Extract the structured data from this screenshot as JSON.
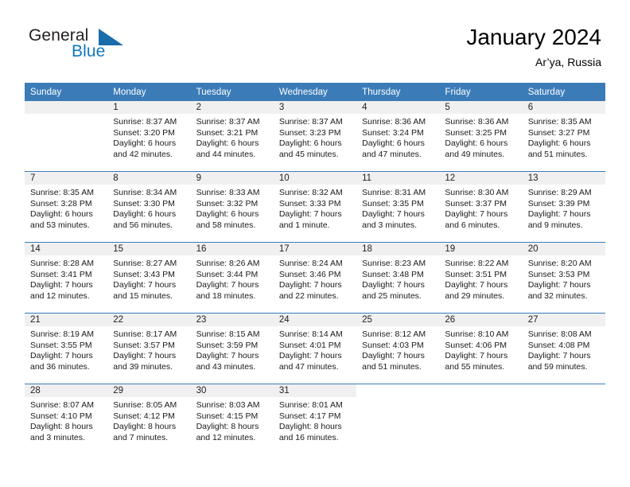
{
  "brand": {
    "name_part1": "General",
    "name_part2": "Blue",
    "triangle_color": "#1b6cab",
    "blue_color": "#1278be"
  },
  "header": {
    "title": "January 2024",
    "location": "Ar’ya, Russia"
  },
  "theme": {
    "header_blue": "#3b7cb8",
    "daynum_band": "#f0f0f0",
    "text": "#000000"
  },
  "calendar": {
    "weekday_headers": [
      "Sunday",
      "Monday",
      "Tuesday",
      "Wednesday",
      "Thursday",
      "Friday",
      "Saturday"
    ],
    "weeks": [
      [
        {
          "day": "",
          "sunrise": "",
          "sunset": "",
          "daylight1": "",
          "daylight2": ""
        },
        {
          "day": "1",
          "sunrise": "Sunrise: 8:37 AM",
          "sunset": "Sunset: 3:20 PM",
          "daylight1": "Daylight: 6 hours",
          "daylight2": "and 42 minutes."
        },
        {
          "day": "2",
          "sunrise": "Sunrise: 8:37 AM",
          "sunset": "Sunset: 3:21 PM",
          "daylight1": "Daylight: 6 hours",
          "daylight2": "and 44 minutes."
        },
        {
          "day": "3",
          "sunrise": "Sunrise: 8:37 AM",
          "sunset": "Sunset: 3:23 PM",
          "daylight1": "Daylight: 6 hours",
          "daylight2": "and 45 minutes."
        },
        {
          "day": "4",
          "sunrise": "Sunrise: 8:36 AM",
          "sunset": "Sunset: 3:24 PM",
          "daylight1": "Daylight: 6 hours",
          "daylight2": "and 47 minutes."
        },
        {
          "day": "5",
          "sunrise": "Sunrise: 8:36 AM",
          "sunset": "Sunset: 3:25 PM",
          "daylight1": "Daylight: 6 hours",
          "daylight2": "and 49 minutes."
        },
        {
          "day": "6",
          "sunrise": "Sunrise: 8:35 AM",
          "sunset": "Sunset: 3:27 PM",
          "daylight1": "Daylight: 6 hours",
          "daylight2": "and 51 minutes."
        }
      ],
      [
        {
          "day": "7",
          "sunrise": "Sunrise: 8:35 AM",
          "sunset": "Sunset: 3:28 PM",
          "daylight1": "Daylight: 6 hours",
          "daylight2": "and 53 minutes."
        },
        {
          "day": "8",
          "sunrise": "Sunrise: 8:34 AM",
          "sunset": "Sunset: 3:30 PM",
          "daylight1": "Daylight: 6 hours",
          "daylight2": "and 56 minutes."
        },
        {
          "day": "9",
          "sunrise": "Sunrise: 8:33 AM",
          "sunset": "Sunset: 3:32 PM",
          "daylight1": "Daylight: 6 hours",
          "daylight2": "and 58 minutes."
        },
        {
          "day": "10",
          "sunrise": "Sunrise: 8:32 AM",
          "sunset": "Sunset: 3:33 PM",
          "daylight1": "Daylight: 7 hours",
          "daylight2": "and 1 minute."
        },
        {
          "day": "11",
          "sunrise": "Sunrise: 8:31 AM",
          "sunset": "Sunset: 3:35 PM",
          "daylight1": "Daylight: 7 hours",
          "daylight2": "and 3 minutes."
        },
        {
          "day": "12",
          "sunrise": "Sunrise: 8:30 AM",
          "sunset": "Sunset: 3:37 PM",
          "daylight1": "Daylight: 7 hours",
          "daylight2": "and 6 minutes."
        },
        {
          "day": "13",
          "sunrise": "Sunrise: 8:29 AM",
          "sunset": "Sunset: 3:39 PM",
          "daylight1": "Daylight: 7 hours",
          "daylight2": "and 9 minutes."
        }
      ],
      [
        {
          "day": "14",
          "sunrise": "Sunrise: 8:28 AM",
          "sunset": "Sunset: 3:41 PM",
          "daylight1": "Daylight: 7 hours",
          "daylight2": "and 12 minutes."
        },
        {
          "day": "15",
          "sunrise": "Sunrise: 8:27 AM",
          "sunset": "Sunset: 3:43 PM",
          "daylight1": "Daylight: 7 hours",
          "daylight2": "and 15 minutes."
        },
        {
          "day": "16",
          "sunrise": "Sunrise: 8:26 AM",
          "sunset": "Sunset: 3:44 PM",
          "daylight1": "Daylight: 7 hours",
          "daylight2": "and 18 minutes."
        },
        {
          "day": "17",
          "sunrise": "Sunrise: 8:24 AM",
          "sunset": "Sunset: 3:46 PM",
          "daylight1": "Daylight: 7 hours",
          "daylight2": "and 22 minutes."
        },
        {
          "day": "18",
          "sunrise": "Sunrise: 8:23 AM",
          "sunset": "Sunset: 3:48 PM",
          "daylight1": "Daylight: 7 hours",
          "daylight2": "and 25 minutes."
        },
        {
          "day": "19",
          "sunrise": "Sunrise: 8:22 AM",
          "sunset": "Sunset: 3:51 PM",
          "daylight1": "Daylight: 7 hours",
          "daylight2": "and 29 minutes."
        },
        {
          "day": "20",
          "sunrise": "Sunrise: 8:20 AM",
          "sunset": "Sunset: 3:53 PM",
          "daylight1": "Daylight: 7 hours",
          "daylight2": "and 32 minutes."
        }
      ],
      [
        {
          "day": "21",
          "sunrise": "Sunrise: 8:19 AM",
          "sunset": "Sunset: 3:55 PM",
          "daylight1": "Daylight: 7 hours",
          "daylight2": "and 36 minutes."
        },
        {
          "day": "22",
          "sunrise": "Sunrise: 8:17 AM",
          "sunset": "Sunset: 3:57 PM",
          "daylight1": "Daylight: 7 hours",
          "daylight2": "and 39 minutes."
        },
        {
          "day": "23",
          "sunrise": "Sunrise: 8:15 AM",
          "sunset": "Sunset: 3:59 PM",
          "daylight1": "Daylight: 7 hours",
          "daylight2": "and 43 minutes."
        },
        {
          "day": "24",
          "sunrise": "Sunrise: 8:14 AM",
          "sunset": "Sunset: 4:01 PM",
          "daylight1": "Daylight: 7 hours",
          "daylight2": "and 47 minutes."
        },
        {
          "day": "25",
          "sunrise": "Sunrise: 8:12 AM",
          "sunset": "Sunset: 4:03 PM",
          "daylight1": "Daylight: 7 hours",
          "daylight2": "and 51 minutes."
        },
        {
          "day": "26",
          "sunrise": "Sunrise: 8:10 AM",
          "sunset": "Sunset: 4:06 PM",
          "daylight1": "Daylight: 7 hours",
          "daylight2": "and 55 minutes."
        },
        {
          "day": "27",
          "sunrise": "Sunrise: 8:08 AM",
          "sunset": "Sunset: 4:08 PM",
          "daylight1": "Daylight: 7 hours",
          "daylight2": "and 59 minutes."
        }
      ],
      [
        {
          "day": "28",
          "sunrise": "Sunrise: 8:07 AM",
          "sunset": "Sunset: 4:10 PM",
          "daylight1": "Daylight: 8 hours",
          "daylight2": "and 3 minutes."
        },
        {
          "day": "29",
          "sunrise": "Sunrise: 8:05 AM",
          "sunset": "Sunset: 4:12 PM",
          "daylight1": "Daylight: 8 hours",
          "daylight2": "and 7 minutes."
        },
        {
          "day": "30",
          "sunrise": "Sunrise: 8:03 AM",
          "sunset": "Sunset: 4:15 PM",
          "daylight1": "Daylight: 8 hours",
          "daylight2": "and 12 minutes."
        },
        {
          "day": "31",
          "sunrise": "Sunrise: 8:01 AM",
          "sunset": "Sunset: 4:17 PM",
          "daylight1": "Daylight: 8 hours",
          "daylight2": "and 16 minutes."
        },
        {
          "day": "",
          "sunrise": "",
          "sunset": "",
          "daylight1": "",
          "daylight2": ""
        },
        {
          "day": "",
          "sunrise": "",
          "sunset": "",
          "daylight1": "",
          "daylight2": ""
        },
        {
          "day": "",
          "sunrise": "",
          "sunset": "",
          "daylight1": "",
          "daylight2": ""
        }
      ]
    ]
  }
}
